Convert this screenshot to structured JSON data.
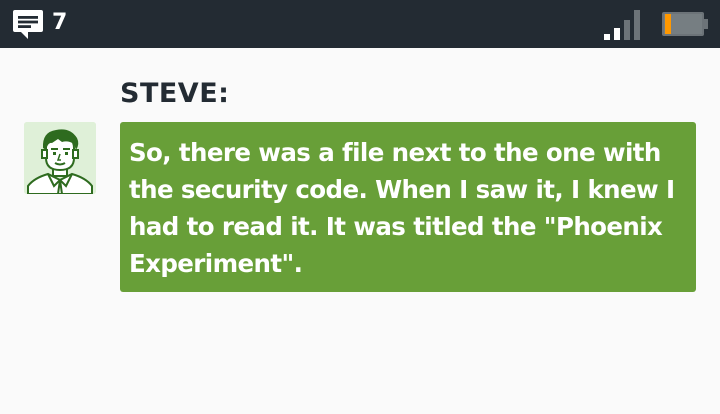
{
  "status_bar": {
    "message_count": "7",
    "icons": {
      "messages": "message-icon",
      "signal": "signal-strength-icon",
      "battery": "battery-low-icon"
    },
    "signal_level": "2 of 4 bars",
    "battery_level": "low",
    "colors": {
      "background": "#232b33",
      "signal_active": "#ffffff",
      "signal_inactive": "#6c7378",
      "battery_fill": "#ff9800"
    }
  },
  "dialogue": {
    "speaker": "STEVE:",
    "avatar_icon": "steve-portrait",
    "text": "So, there was a file next to the one with the security code. When I saw it, I knew I had to read it. It was titled the \"Phoenix Experiment\".",
    "colors": {
      "bubble": "#689f38",
      "bubble_text": "#ffffff",
      "speaker": "#232b33",
      "avatar_background": "#dff0d8"
    }
  }
}
